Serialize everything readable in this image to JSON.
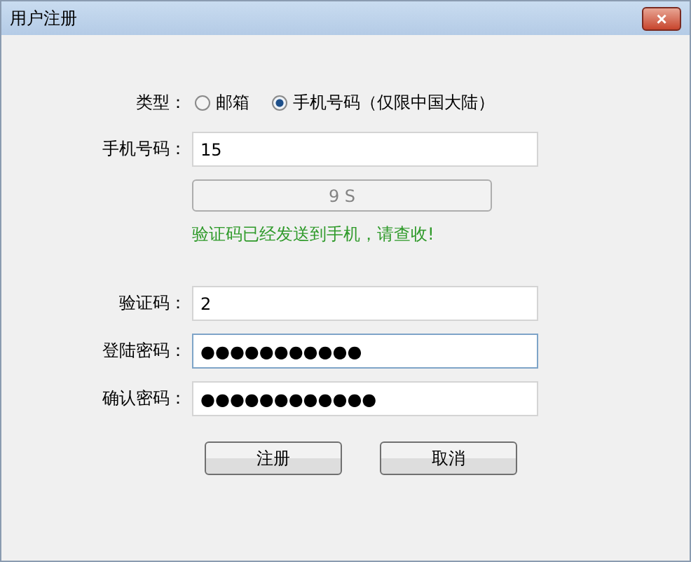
{
  "window": {
    "title": "用户注册",
    "close": "×"
  },
  "type": {
    "label": "类型：",
    "options": [
      {
        "label": "邮箱",
        "selected": false
      },
      {
        "label": "手机号码（仅限中国大陆）",
        "selected": true
      }
    ]
  },
  "phone": {
    "label": "手机号码：",
    "value": "15"
  },
  "send_button": {
    "label": "9 S",
    "disabled": true
  },
  "message": "验证码已经发送到手机，请查收!",
  "fields": [
    {
      "label": "验证码：",
      "value": "2",
      "focused": false
    },
    {
      "label": "登陆密码：",
      "value": "●●●●●●●●●●●",
      "focused": true
    },
    {
      "label": "确认密码：",
      "value": "●●●●●●●●●●●●",
      "focused": false
    }
  ],
  "buttons": [
    "注册",
    "取消"
  ]
}
